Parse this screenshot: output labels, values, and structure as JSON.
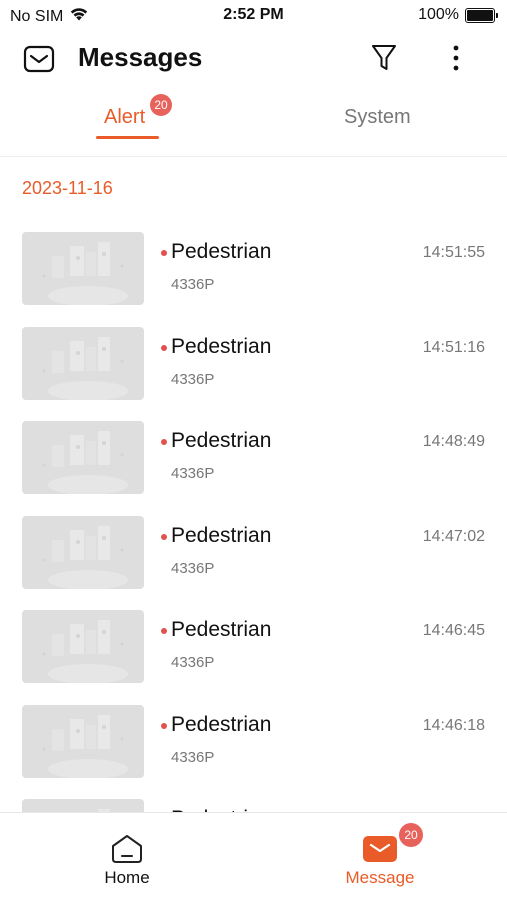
{
  "status": {
    "carrier": "No SIM",
    "time": "2:52 PM",
    "battery": "100%"
  },
  "header": {
    "title": "Messages"
  },
  "tabs": [
    {
      "label": "Alert",
      "badge": "20",
      "active": true
    },
    {
      "label": "System",
      "active": false
    }
  ],
  "date_group": "2023-11-16",
  "messages": [
    {
      "name": "Pedestrian",
      "device": "4336P",
      "time": "14:51:55"
    },
    {
      "name": "Pedestrian",
      "device": "4336P",
      "time": "14:51:16"
    },
    {
      "name": "Pedestrian",
      "device": "4336P",
      "time": "14:48:49"
    },
    {
      "name": "Pedestrian",
      "device": "4336P",
      "time": "14:47:02"
    },
    {
      "name": "Pedestrian",
      "device": "4336P",
      "time": "14:46:45"
    },
    {
      "name": "Pedestrian",
      "device": "4336P",
      "time": "14:46:18"
    },
    {
      "name": "Pedestrian",
      "device": "",
      "time": ""
    }
  ],
  "tabbar": {
    "home_label": "Home",
    "message_label": "Message",
    "message_badge": "20"
  },
  "colors": {
    "accent": "#ea5b2a",
    "badge": "#e8625c",
    "unread_dot": "#e0524d"
  },
  "icons": [
    "wifi-icon",
    "battery-icon",
    "mail-icon",
    "filter-icon",
    "more-icon",
    "home-icon",
    "message-icon"
  ]
}
